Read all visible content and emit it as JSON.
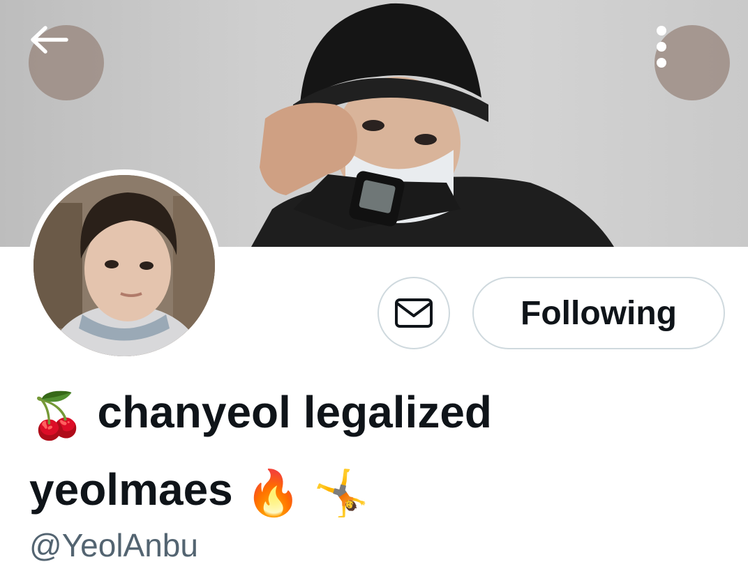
{
  "header": {
    "back_icon": "arrow-left-icon",
    "more_icon": "more-vertical-icon"
  },
  "profile": {
    "banner_description": "banner-photo",
    "avatar_description": "avatar-photo",
    "display_name_line1": "chanyeol legalized",
    "display_name_line2": "yeolmaes",
    "emoji_cherry": "🍒",
    "emoji_fire": "🔥",
    "emoji_cartwheel": "🤸",
    "handle": "@YeolAnbu"
  },
  "actions": {
    "message_icon": "envelope-icon",
    "following_label": "Following"
  },
  "colors": {
    "text_primary": "#0f1419",
    "text_secondary": "#536471",
    "border": "#cfd9de",
    "overlay_button": "#968278"
  }
}
